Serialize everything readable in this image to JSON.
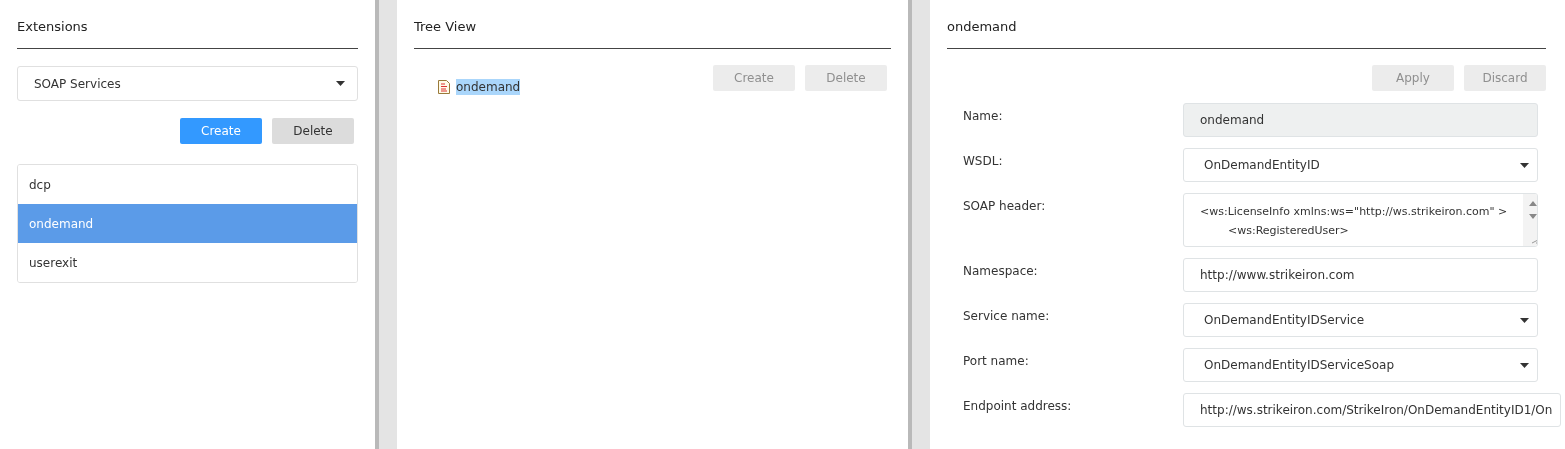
{
  "extensions": {
    "title": "Extensions",
    "type_select": {
      "value": "SOAP Services"
    },
    "buttons": [
      {
        "label": "Create",
        "kind": "primary"
      },
      {
        "label": "Delete",
        "kind": "secondary"
      }
    ],
    "items": [
      {
        "label": "dcp",
        "selected": false
      },
      {
        "label": "ondemand",
        "selected": true
      },
      {
        "label": "userexit",
        "selected": false
      }
    ]
  },
  "tree_view": {
    "title": "Tree View",
    "buttons": [
      {
        "label": "Create",
        "disabled": true
      },
      {
        "label": "Delete",
        "disabled": true
      }
    ],
    "nodes": [
      {
        "label": "ondemand",
        "selected": true
      }
    ]
  },
  "details": {
    "title": "ondemand",
    "buttons": [
      {
        "label": "Apply",
        "disabled": true
      },
      {
        "label": "Discard",
        "disabled": true
      }
    ],
    "fields": [
      {
        "label": "Name:",
        "kind": "readonly",
        "value": "ondemand"
      },
      {
        "label": "WSDL:",
        "kind": "select",
        "value": "OnDemandEntityID"
      },
      {
        "label": "SOAP header:",
        "kind": "textarea",
        "lines": [
          "<ws:LicenseInfo xmlns:ws=\"http://ws.strikeiron.com\" >",
          "<ws:RegisteredUser>"
        ]
      },
      {
        "label": "Namespace:",
        "kind": "text",
        "value": "http://www.strikeiron.com"
      },
      {
        "label": "Service name:",
        "kind": "select",
        "value": "OnDemandEntityIDService"
      },
      {
        "label": "Port name:",
        "kind": "select",
        "value": "OnDemandEntityIDServiceSoap"
      },
      {
        "label": "Endpoint address:",
        "kind": "text",
        "value": "http://ws.strikeiron.com/StrikeIron/OnDemandEntityID1/On"
      }
    ]
  }
}
